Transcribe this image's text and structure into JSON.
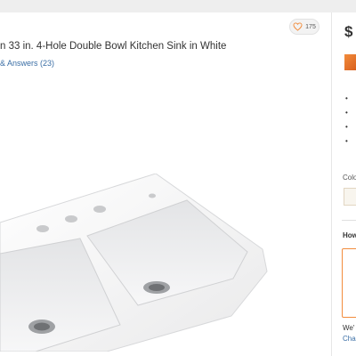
{
  "product": {
    "title": "n 33 in. 4-Hole Double Bowl Kitchen Sink in White",
    "qa_link": "& Answers (23)",
    "favorite_count": "175"
  },
  "purchase": {
    "price": "$",
    "bullets": [
      "•",
      "•",
      "•",
      "•"
    ],
    "color_label": "Colo",
    "color_swatch": "#f8f5ee",
    "how_label": "How",
    "note": "We'",
    "change_link": "Cha"
  },
  "colors": {
    "accent": "#f28c3c",
    "link": "#3a6ea5",
    "text": "#333333"
  },
  "icons": {
    "favorite": "heart-outline-icon"
  }
}
